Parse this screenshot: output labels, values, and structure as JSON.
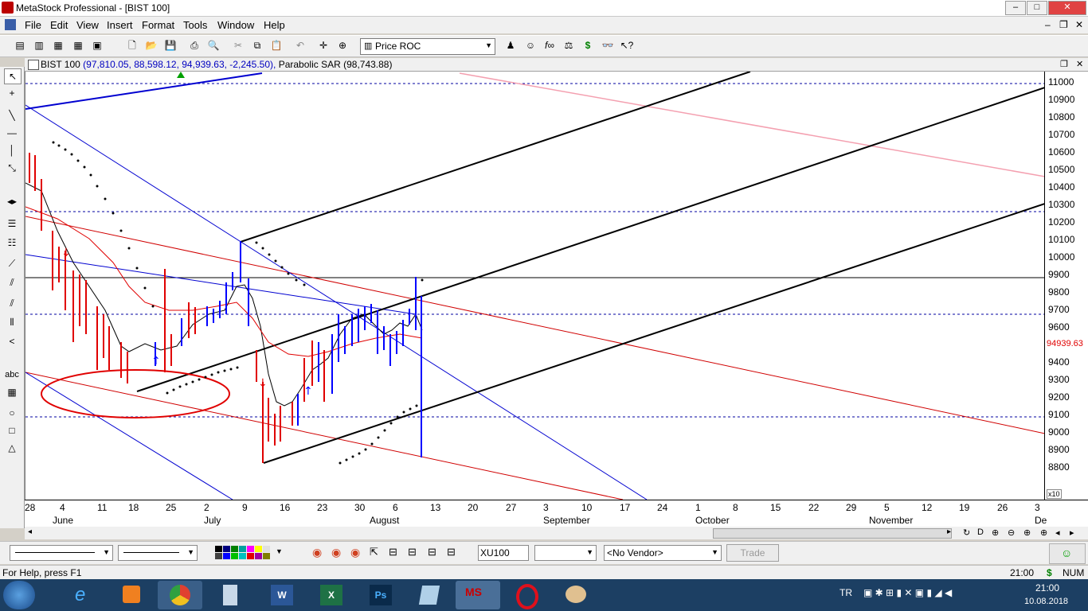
{
  "window": {
    "title": "MetaStock Professional - [BIST 100]"
  },
  "menu": [
    "File",
    "Edit",
    "View",
    "Insert",
    "Format",
    "Tools",
    "Window",
    "Help"
  ],
  "toolbar": {
    "indicator": "Price ROC"
  },
  "chart": {
    "header_symbol": "BIST 100",
    "header_values": "(97,810.05, 88,598.12, 94,939.63, -2,245.50),",
    "header_indicator": "Parabolic SAR",
    "header_indicator_value": "(98,743.88)",
    "last_price": "94939.63",
    "y_labels": [
      "11000",
      "10900",
      "10800",
      "10700",
      "10600",
      "10500",
      "10400",
      "10300",
      "10200",
      "10100",
      "10000",
      "9900",
      "9800",
      "9700",
      "9600",
      "9500",
      "9400",
      "9300",
      "9200",
      "9100",
      "9000",
      "8900",
      "8800"
    ],
    "x_ticks": [
      "28",
      "4",
      "11",
      "18",
      "25",
      "2",
      "9",
      "16",
      "23",
      "30",
      "6",
      "13",
      "20",
      "27",
      "3",
      "10",
      "17",
      "24",
      "1",
      "8",
      "15",
      "22",
      "29",
      "5",
      "12",
      "19",
      "26",
      "3"
    ],
    "x_months": [
      "June",
      "July",
      "August",
      "September",
      "October",
      "November",
      "De"
    ],
    "scale_note": "x10"
  },
  "drawbar": {
    "symbol": "XU100",
    "vendor": "<No Vendor>",
    "trade_label": "Trade"
  },
  "status": {
    "help": "For Help, press F1",
    "time": "21:00",
    "num": "NUM",
    "currency_icon": "$"
  },
  "taskbar": {
    "lang": "TR",
    "clock_time": "21:00",
    "clock_date": "10.08.2018"
  },
  "colors": {
    "up_bar": "#0000ff",
    "down_bar": "#e00000",
    "trendline": "#000000",
    "sar": "#000000"
  }
}
